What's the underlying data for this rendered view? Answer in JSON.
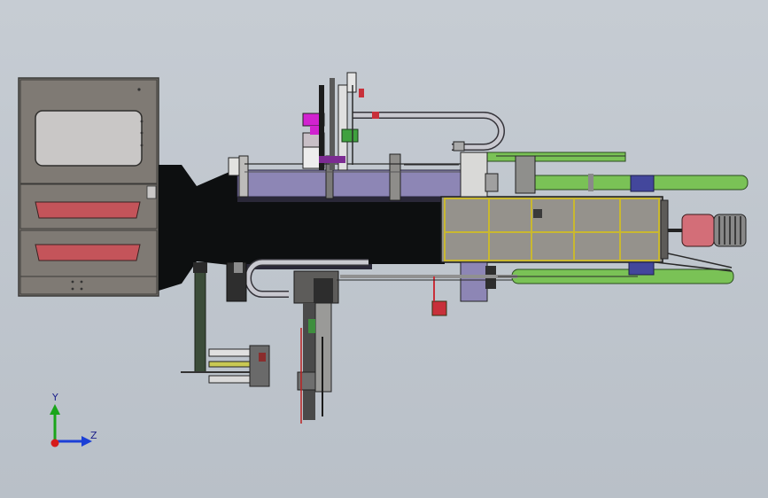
{
  "viewport": {
    "background_top": "#c6ccd3",
    "background_bottom": "#b9c0c8"
  },
  "triad": {
    "y_label": "Y",
    "z_label": "Z",
    "y_axis_color": "#1aa51a",
    "z_axis_color": "#1b3fd6",
    "x_axis_color": "#d61b1b"
  },
  "colors": {
    "cabinet": "#7d7872",
    "cabinet_edge": "#3b3a38",
    "window_panel": "#c9c7c6",
    "vent_slot": "#c4545a",
    "body_black": "#0d0f10",
    "frame_purple": "#8d86b5",
    "yellow_frame": "#c9b830",
    "cylinder_green": "#7ac256",
    "magenta": "#d222d0",
    "red_part": "#c8303a",
    "pink_roller": "#d36e78"
  }
}
